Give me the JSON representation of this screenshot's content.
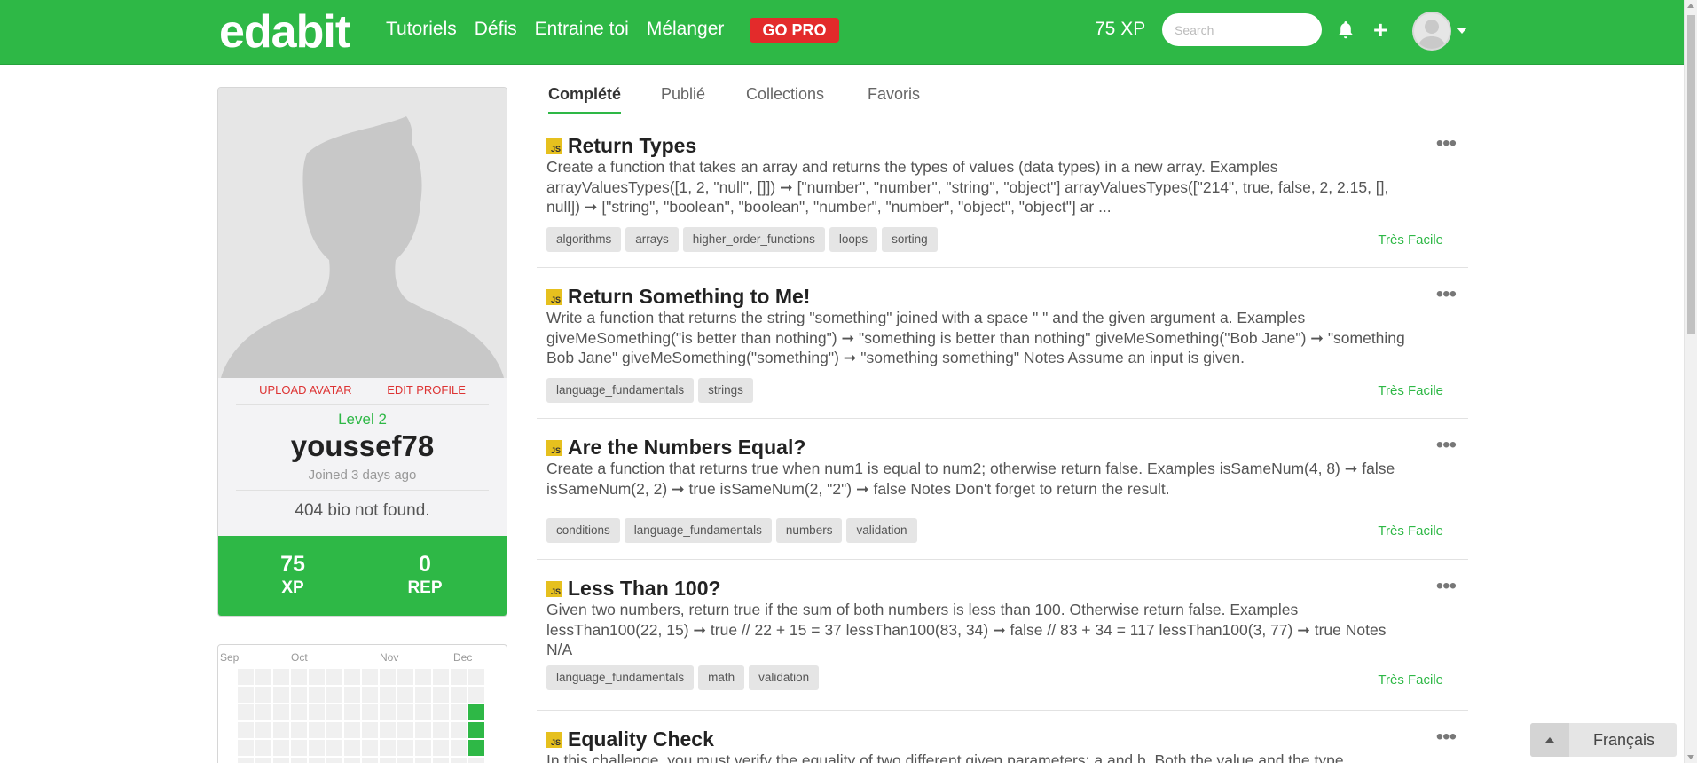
{
  "header": {
    "logo": "edabit",
    "nav": [
      "Tutoriels",
      "Défis",
      "Entraine toi",
      "Mélanger"
    ],
    "gopro": "GO PRO",
    "xp": "75 XP",
    "search_placeholder": "Search",
    "icons": [
      "bell-icon",
      "plus-icon",
      "avatar",
      "chevron-down-icon"
    ]
  },
  "profile": {
    "upload_avatar": "UPLOAD AVATAR",
    "edit_profile": "EDIT PROFILE",
    "level": "Level 2",
    "username": "youssef78",
    "joined": "Joined 3 days ago",
    "bio": "404 bio not found.",
    "stats": [
      {
        "value": "75",
        "label": "XP"
      },
      {
        "value": "0",
        "label": "REP"
      }
    ]
  },
  "heatmap": {
    "months": [
      "Sep",
      "Oct",
      "Nov",
      "Dec"
    ],
    "active_color": "#2eb846"
  },
  "tabs": [
    "Complété",
    "Publié",
    "Collections",
    "Favoris"
  ],
  "challenges": [
    {
      "title": "Return Types",
      "description": "Create a function that takes an array and returns the types of values (data types) in a new array. Examples arrayValuesTypes([1, 2, \"null\", []]) ➞ [\"number\", \"number\", \"string\", \"object\"] arrayValuesTypes([\"214\", true, false, 2, 2.15, [], null]) ➞ [\"string\", \"boolean\", \"boolean\", \"number\", \"number\", \"object\", \"object\"] ar ...",
      "tags": [
        "algorithms",
        "arrays",
        "higher_order_functions",
        "loops",
        "sorting"
      ],
      "difficulty": "Très Facile"
    },
    {
      "title": "Return Something to Me!",
      "description": "Write a function that returns the string \"something\" joined with a space \" \" and the given argument a. Examples giveMeSomething(\"is better than nothing\") ➞ \"something is better than nothing\" giveMeSomething(\"Bob Jane\") ➞ \"something Bob Jane\" giveMeSomething(\"something\") ➞ \"something something\" Notes Assume an input is given.",
      "tags": [
        "language_fundamentals",
        "strings"
      ],
      "difficulty": "Très Facile"
    },
    {
      "title": "Are the Numbers Equal?",
      "description": "Create a function that returns true when num1 is equal to num2; otherwise return false. Examples isSameNum(4, 8) ➞ false isSameNum(2, 2) ➞ true isSameNum(2, \"2\") ➞ false Notes Don't forget to return the result.",
      "tags": [
        "conditions",
        "language_fundamentals",
        "numbers",
        "validation"
      ],
      "difficulty": "Très Facile"
    },
    {
      "title": "Less Than 100?",
      "description": "Given two numbers, return true if the sum of both numbers is less than 100. Otherwise return false. Examples lessThan100(22, 15) ➞ true // 22 + 15 = 37 lessThan100(83, 34) ➞ false // 83 + 34 = 117 lessThan100(3, 77) ➞ true Notes N/A",
      "tags": [
        "language_fundamentals",
        "math",
        "validation"
      ],
      "difficulty": "Très Facile"
    },
    {
      "title": "Equality Check",
      "description": "In this challenge, you must verify the equality of two different given parameters: a and b. Both the value and the type",
      "tags": [],
      "difficulty": ""
    }
  ],
  "language": "Français",
  "colors": {
    "brand": "#2eb846",
    "gopro": "#e32b2b",
    "js_badge": "#e6c01e",
    "link_red": "#d33333"
  }
}
